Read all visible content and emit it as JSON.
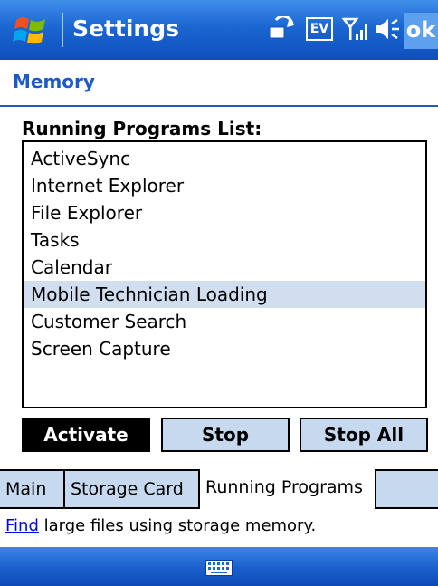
{
  "window": {
    "title": "Settings",
    "ok_label": "ok"
  },
  "status_icons": [
    "sync-icon",
    "ev-icon",
    "signal-icon",
    "volume-icon"
  ],
  "status_texts": {
    "ev": "EV"
  },
  "page": {
    "title": "Memory"
  },
  "list": {
    "label": "Running Programs List:",
    "items": [
      "ActiveSync",
      "Internet Explorer",
      "File Explorer",
      "Tasks",
      "Calendar",
      "Mobile Technician Loading",
      "Customer Search",
      "Screen Capture"
    ],
    "selected_index": 5
  },
  "buttons": {
    "activate": "Activate",
    "stop": "Stop",
    "stop_all": "Stop All"
  },
  "tabs": [
    "Main",
    "Storage Card",
    "Running Programs"
  ],
  "active_tab": "Running Programs",
  "footer": {
    "link": "Find",
    "text": " large files using storage memory."
  },
  "colors": {
    "titlebar": "#1b66d2",
    "accent": "#1c5bc5",
    "tab_bg": "#c6d9ef",
    "selection": "#d1def0",
    "link": "#0000ee"
  }
}
